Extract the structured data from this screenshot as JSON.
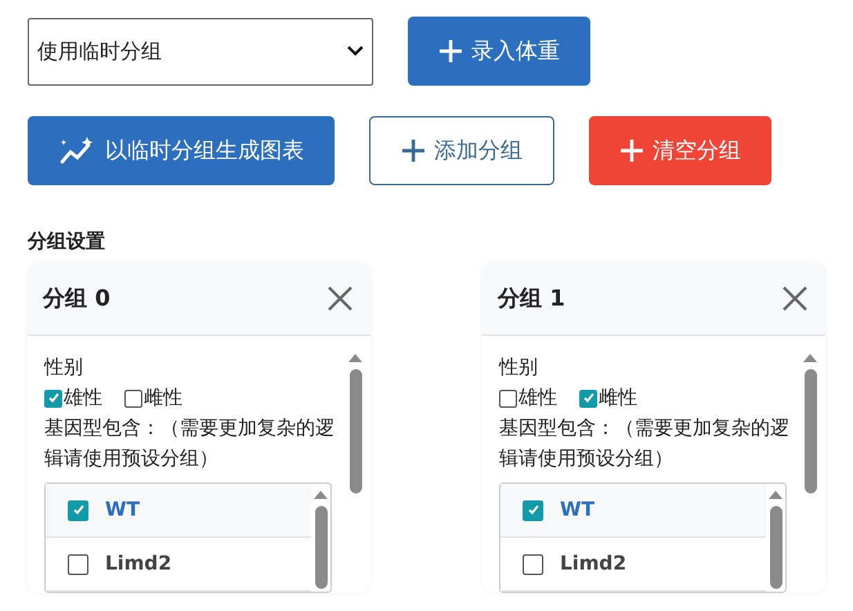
{
  "mode_select": {
    "value": "使用临时分组"
  },
  "actions": [
    {
      "label": "录入体重",
      "kind": "plus"
    },
    {
      "label": "以临时分组生成图表",
      "kind": "chart"
    },
    {
      "label": "添加分组",
      "kind": "plus"
    },
    {
      "label": "清空分组",
      "kind": "plus"
    }
  ],
  "section_title": "分组设置",
  "groups": [
    {
      "title": "分组 0",
      "sex_label": "性别",
      "sexes": [
        {
          "label": "雄性",
          "checked": true
        },
        {
          "label": "雌性",
          "checked": false
        }
      ],
      "genotype_label": "基因型包含：（需要更加复杂的逻辑请使用预设分组）",
      "genotypes": [
        {
          "label": "WT",
          "checked": true
        },
        {
          "label": "Limd2",
          "checked": false
        }
      ]
    },
    {
      "title": "分组 1",
      "sex_label": "性别",
      "sexes": [
        {
          "label": "雄性",
          "checked": false
        },
        {
          "label": "雌性",
          "checked": true
        }
      ],
      "genotype_label": "基因型包含：（需要更加复杂的逻辑请使用预设分组）",
      "genotypes": [
        {
          "label": "WT",
          "checked": true
        },
        {
          "label": "Limd2",
          "checked": false
        }
      ]
    }
  ]
}
